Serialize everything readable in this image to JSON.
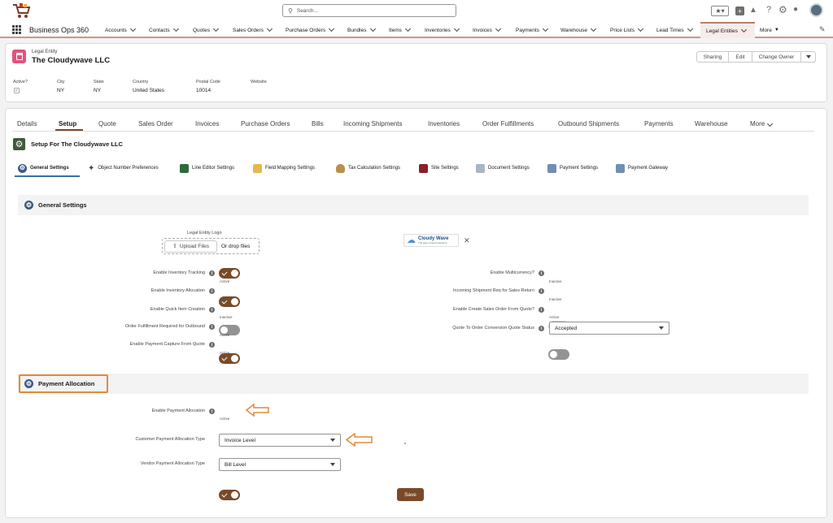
{
  "app": {
    "name": "Business Ops 360"
  },
  "search": {
    "placeholder": "Search..."
  },
  "nav": {
    "items": [
      "Accounts",
      "Contacts",
      "Quotes",
      "Sales Orders",
      "Purchase Orders",
      "Bundles",
      "Items",
      "Inventories",
      "Invoices",
      "Payments",
      "Warehouse",
      "Price Lists",
      "Lead Times",
      "Legal Entities"
    ],
    "more": "More"
  },
  "record": {
    "type": "Legal Entity",
    "name": "The Cloudywave LLC",
    "actions": [
      "Sharing",
      "Edit",
      "Change Owner"
    ]
  },
  "fields": {
    "labels": [
      "Active?",
      "City",
      "State",
      "Country",
      "Postal Code",
      "Website"
    ],
    "values": [
      "",
      "NY",
      "NY",
      "United States",
      "10014",
      ""
    ]
  },
  "tabs": {
    "items": [
      "Details",
      "Setup",
      "Quote",
      "Sales Order",
      "Invoices",
      "Purchase Orders",
      "Bills",
      "Incoming Shipments",
      "Inventories",
      "Order Fulfillments",
      "Outbound Shipments",
      "Payments",
      "Warehouse"
    ],
    "more": "More",
    "active": "Setup"
  },
  "setup": {
    "title": "Setup For The Cloudywave LLC"
  },
  "subtabs": {
    "items": [
      "General Settings",
      "Object Number Preferences",
      "Line Editor Settings",
      "Field Mapping Settings",
      "Tax Calculation Settings",
      "Site Settings",
      "Document Settings",
      "Payment Settings",
      "Payment Gateway"
    ]
  },
  "general": {
    "title": "General Settings",
    "logo_label": "Legal Entity Logo",
    "upload": "Upload Files",
    "drop": "Or drop files",
    "logo_name": "Cloudy Wave",
    "logo_tag": "The way of cloud solutions"
  },
  "left_settings": [
    {
      "label": "Enable Inventory Tracking",
      "state": "Active"
    },
    {
      "label": "Enable Inventory Allocation",
      "state": "Active"
    },
    {
      "label": "Enable Quick Item Creation",
      "state": "Inactive"
    },
    {
      "label": "Order Fulfillment Required for Outbound",
      "state": "Active"
    },
    {
      "label": "Enable Payment Capture From Quote",
      "state": "Active"
    }
  ],
  "right_settings": [
    {
      "label": "Enable Multicurrency?",
      "state": "Inactive"
    },
    {
      "label": "Incoming Shipment Req for Sales Return",
      "state": "Inactive"
    },
    {
      "label": "Enable Create Sales Order From Quote?",
      "state": "Active"
    }
  ],
  "quote_status": {
    "label": "Quote To Order Conversion Quote Status",
    "value": "Accepted"
  },
  "payment": {
    "title": "Payment Allocation",
    "enable_label": "Enable Payment Allocation",
    "enable_state": "Active",
    "customer_label": "Customer Payment Allocation Type",
    "customer_value": "Invoice Level",
    "vendor_label": "Vendor Payment Allocation Type",
    "vendor_value": "Bill Level"
  },
  "save": "Save",
  "colors": {
    "brand": "#7a4a27",
    "highlight": "#e08a3c",
    "nav_active_bg": "#f7ecea"
  }
}
